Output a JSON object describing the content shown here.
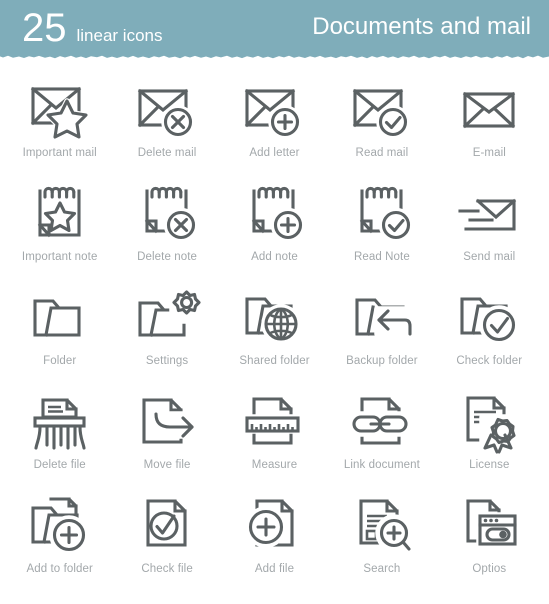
{
  "header": {
    "count": "25",
    "subtitle": "linear icons",
    "title": "Documents and mail",
    "bg_color": "#7fadba",
    "text_color": "#ffffff",
    "torn_edge": true
  },
  "style": {
    "icon_stroke_color": "#5b6163",
    "caption_color": "#a3a8ab",
    "page_bg": "#ffffff"
  },
  "grid": {
    "columns": 5,
    "rows": 5,
    "total_icons": 25
  },
  "icons": [
    {
      "id": "important-mail",
      "label": "Important mail",
      "glyph": "envelope-star"
    },
    {
      "id": "delete-mail",
      "label": "Delete mail",
      "glyph": "envelope-x"
    },
    {
      "id": "add-letter",
      "label": "Add letter",
      "glyph": "envelope-plus"
    },
    {
      "id": "read-mail",
      "label": "Read mail",
      "glyph": "envelope-check"
    },
    {
      "id": "e-mail",
      "label": "E-mail",
      "glyph": "envelope"
    },
    {
      "id": "important-note",
      "label": "Important note",
      "glyph": "note-star"
    },
    {
      "id": "delete-note",
      "label": "Delete note",
      "glyph": "note-x"
    },
    {
      "id": "add-note",
      "label": "Add note",
      "glyph": "note-plus"
    },
    {
      "id": "read-note",
      "label": "Read Note",
      "glyph": "note-check"
    },
    {
      "id": "send-mail",
      "label": "Send mail",
      "glyph": "envelope-send"
    },
    {
      "id": "folder",
      "label": "Folder",
      "glyph": "folder"
    },
    {
      "id": "settings",
      "label": "Settings",
      "glyph": "folder-gear"
    },
    {
      "id": "shared-folder",
      "label": "Shared folder",
      "glyph": "folder-globe"
    },
    {
      "id": "backup-folder",
      "label": "Backup folder",
      "glyph": "folder-arrow-left"
    },
    {
      "id": "check-folder",
      "label": "Check folder",
      "glyph": "folder-check"
    },
    {
      "id": "delete-file",
      "label": "Delete file",
      "glyph": "shredder"
    },
    {
      "id": "move-file",
      "label": "Move file",
      "glyph": "file-arrow-right"
    },
    {
      "id": "measure",
      "label": "Measure",
      "glyph": "file-ruler"
    },
    {
      "id": "link-document",
      "label": "Link document",
      "glyph": "file-chain"
    },
    {
      "id": "license",
      "label": "License",
      "glyph": "file-rosette"
    },
    {
      "id": "add-to-folder",
      "label": "Add to folder",
      "glyph": "folder-file-plus"
    },
    {
      "id": "check-file",
      "label": "Check file",
      "glyph": "file-check"
    },
    {
      "id": "add-file",
      "label": "Add file",
      "glyph": "file-plus"
    },
    {
      "id": "search",
      "label": "Search",
      "glyph": "file-magnifier-plus"
    },
    {
      "id": "optios",
      "label": "Optios",
      "glyph": "file-window-toggle"
    }
  ]
}
